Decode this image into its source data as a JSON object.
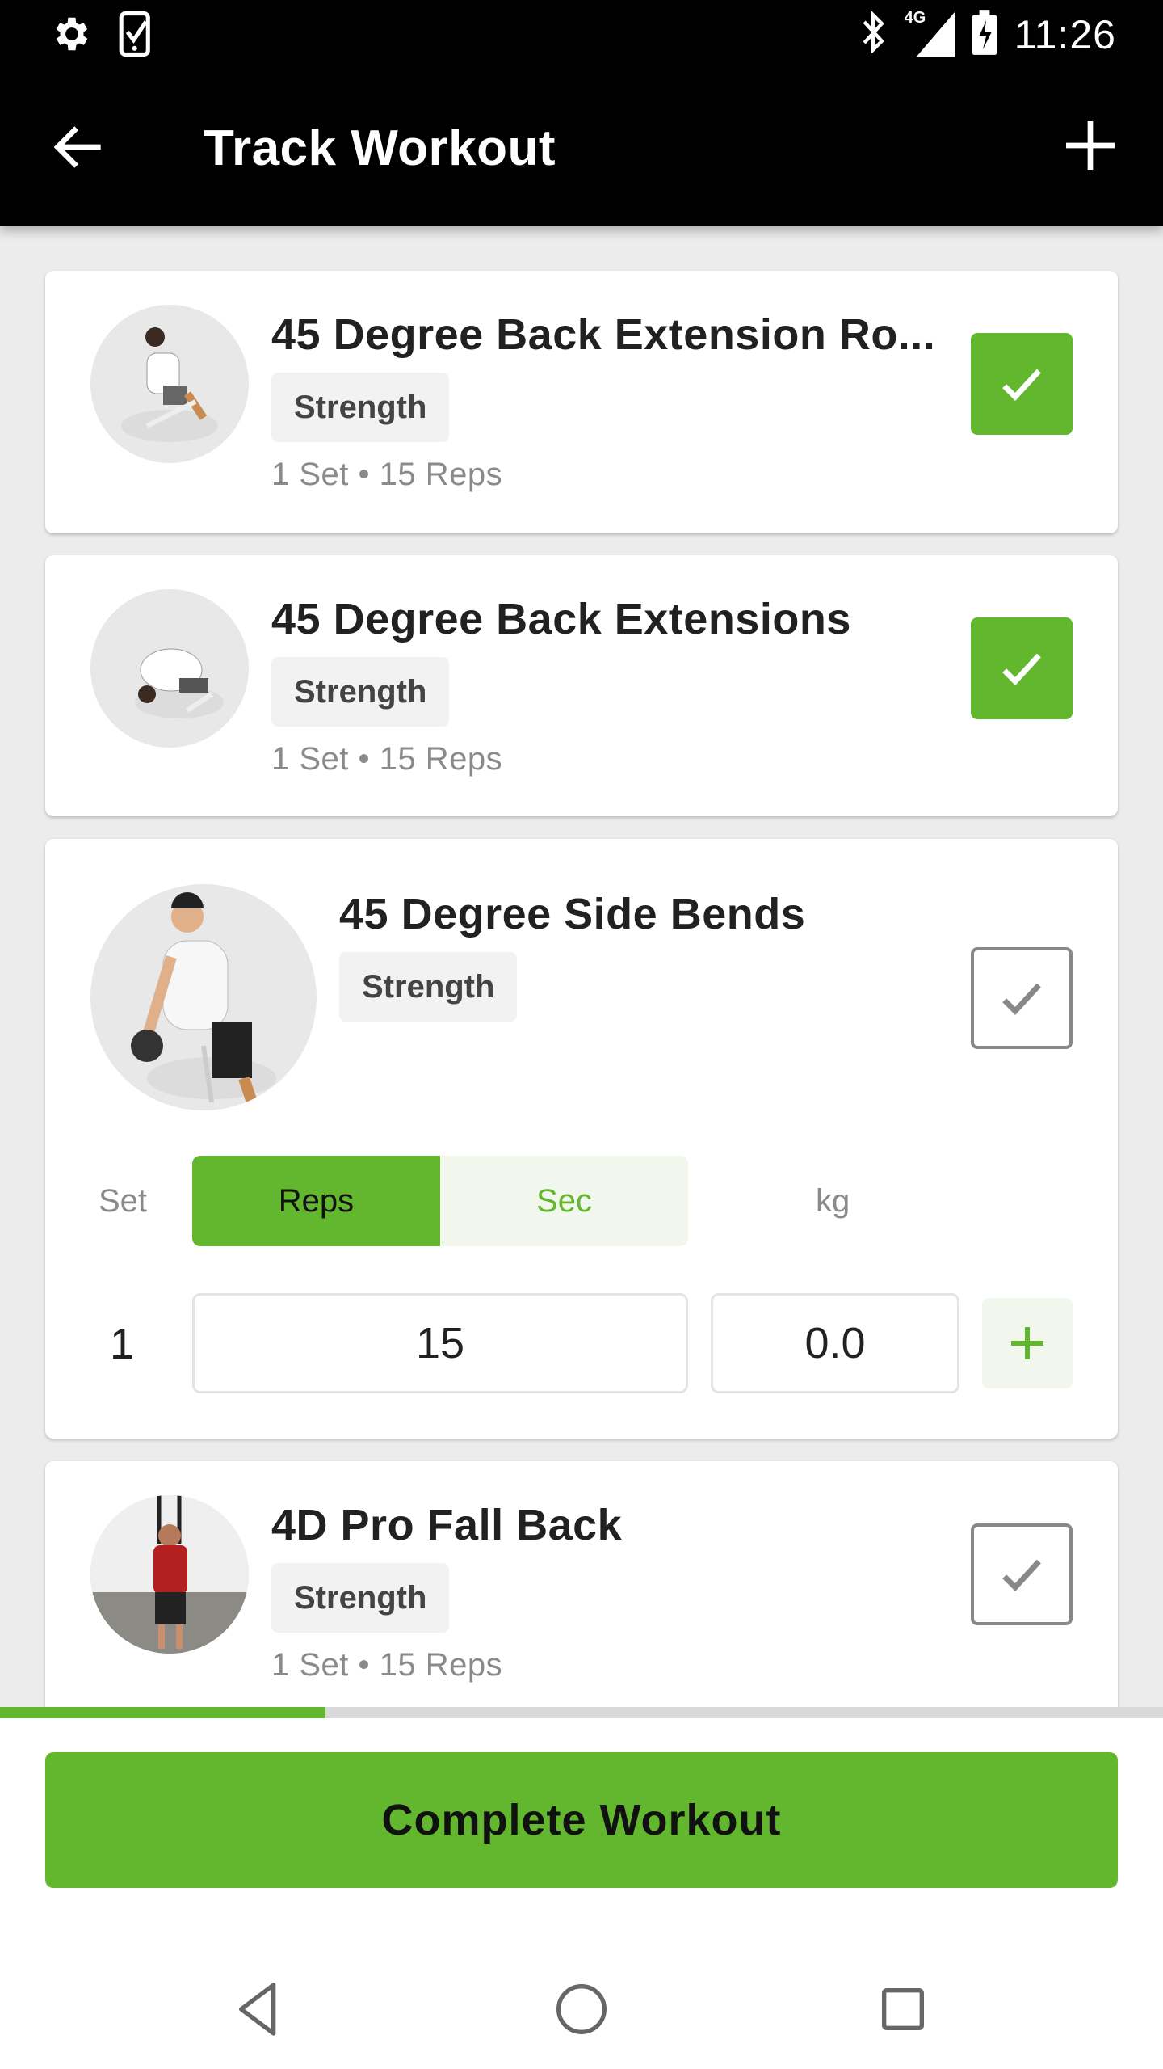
{
  "status_bar": {
    "time": "11:26",
    "left_icons": [
      "gear-icon",
      "phone-check-icon"
    ],
    "right_icons": [
      "bluetooth-icon",
      "signal-4g-icon",
      "battery-charging-icon"
    ],
    "network_label": "4G"
  },
  "app_bar": {
    "title": "Track Workout",
    "back_icon": "arrow-left-icon",
    "add_icon": "plus-icon"
  },
  "exercises": [
    {
      "name": "45 Degree Back Extension Ro...",
      "tag": "Strength",
      "meta": "1 Set • 15 Reps",
      "completed": true,
      "expanded": false
    },
    {
      "name": "45 Degree Back Extensions",
      "tag": "Strength",
      "meta": "1 Set • 15 Reps",
      "completed": true,
      "expanded": false
    },
    {
      "name": "45 Degree Side Bends",
      "tag": "Strength",
      "completed": false,
      "expanded": true,
      "sets_header": {
        "set_label": "Set",
        "mode_options": [
          "Reps",
          "Sec"
        ],
        "selected_mode": "Reps",
        "weight_label": "kg"
      },
      "sets": [
        {
          "number": "1",
          "reps": "15",
          "weight": "0.0"
        }
      ]
    },
    {
      "name": "4D Pro Fall Back",
      "tag": "Strength",
      "meta": "1 Set • 15 Reps",
      "completed": false,
      "expanded": false
    }
  ],
  "progress": {
    "fraction": 0.28
  },
  "complete_button": {
    "label": "Complete Workout"
  },
  "colors": {
    "accent": "#63b72f",
    "accent_light": "#f1f7ec",
    "app_bar": "#000000",
    "background": "#ececec"
  },
  "nav_bar": {
    "items": [
      "back-triangle-icon",
      "home-circle-icon",
      "recents-square-icon"
    ]
  }
}
